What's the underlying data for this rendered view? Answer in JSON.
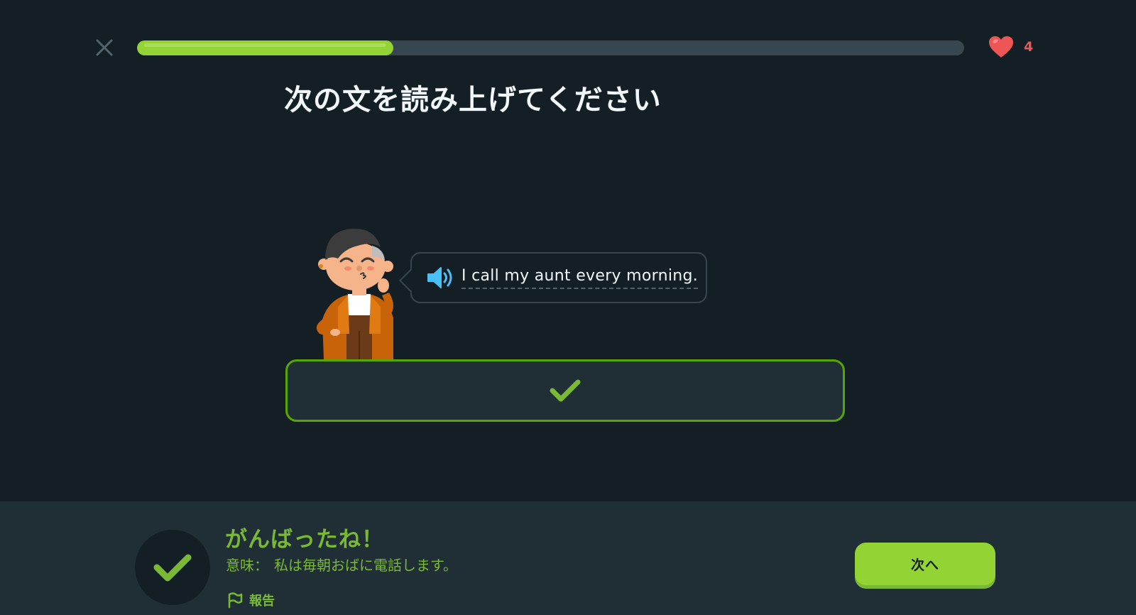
{
  "header": {
    "progress": 0.31,
    "hearts": "4"
  },
  "prompt": {
    "title": "次の文を読み上げてください"
  },
  "bubble": {
    "sentence": "I call my aunt every morning."
  },
  "footer": {
    "result_title": "がんばったね！",
    "meaning_label": "意味：",
    "meaning_text": "私は毎朝おばに電話します。",
    "report_label": "報告",
    "next_label": "次へ"
  },
  "colors": {
    "background": "#131f24",
    "footer_background": "#202f36",
    "accent_green": "#93d333",
    "success_text": "#79b933",
    "heart_red": "#ee5555",
    "speaker_blue": "#49c0f8"
  },
  "icons": {
    "close": "close-icon",
    "heart": "heart-icon",
    "speaker": "speaker-icon",
    "check": "check-icon",
    "flag": "flag-icon"
  }
}
